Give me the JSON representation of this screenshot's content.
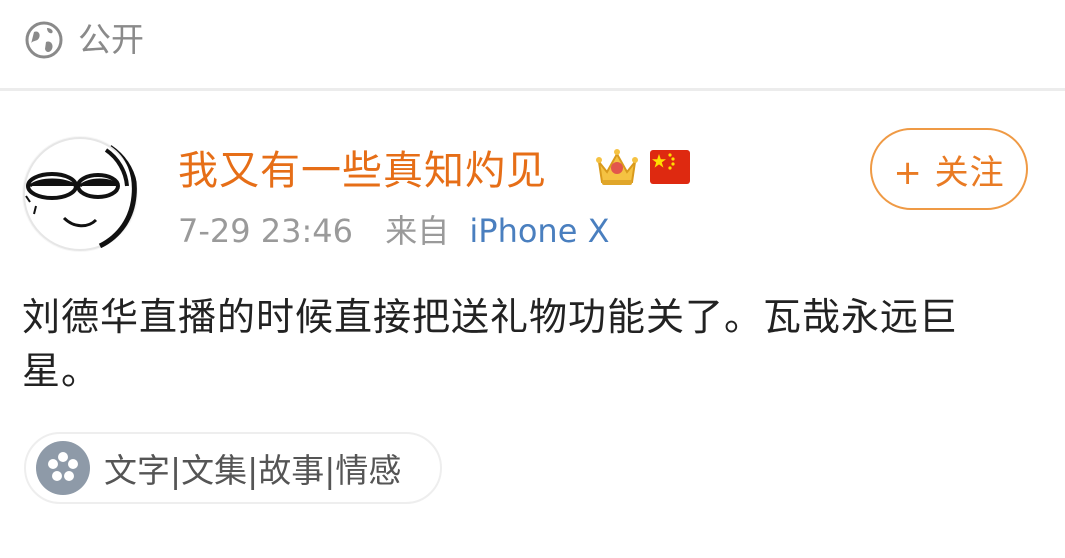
{
  "visibility": {
    "label": "公开",
    "icon": "globe-icon"
  },
  "post": {
    "author": "我又有一些真知灼见",
    "badges": [
      "crown-icon",
      "china-flag-icon"
    ],
    "follow_label": "+ 关注",
    "timestamp": "7-29 23:46",
    "source_label": "来自",
    "source_device": "iPhone X",
    "text": "刘德华直播的时候直接把送礼物功能关了。瓦哉永远巨星。"
  },
  "topic": {
    "label": "文字|文集|故事|情感",
    "icon": "flower-icon"
  },
  "colors": {
    "username": "#e66e17",
    "follow_border": "#ef9a45",
    "link": "#4a7fbf",
    "muted": "#9a9a9a"
  }
}
